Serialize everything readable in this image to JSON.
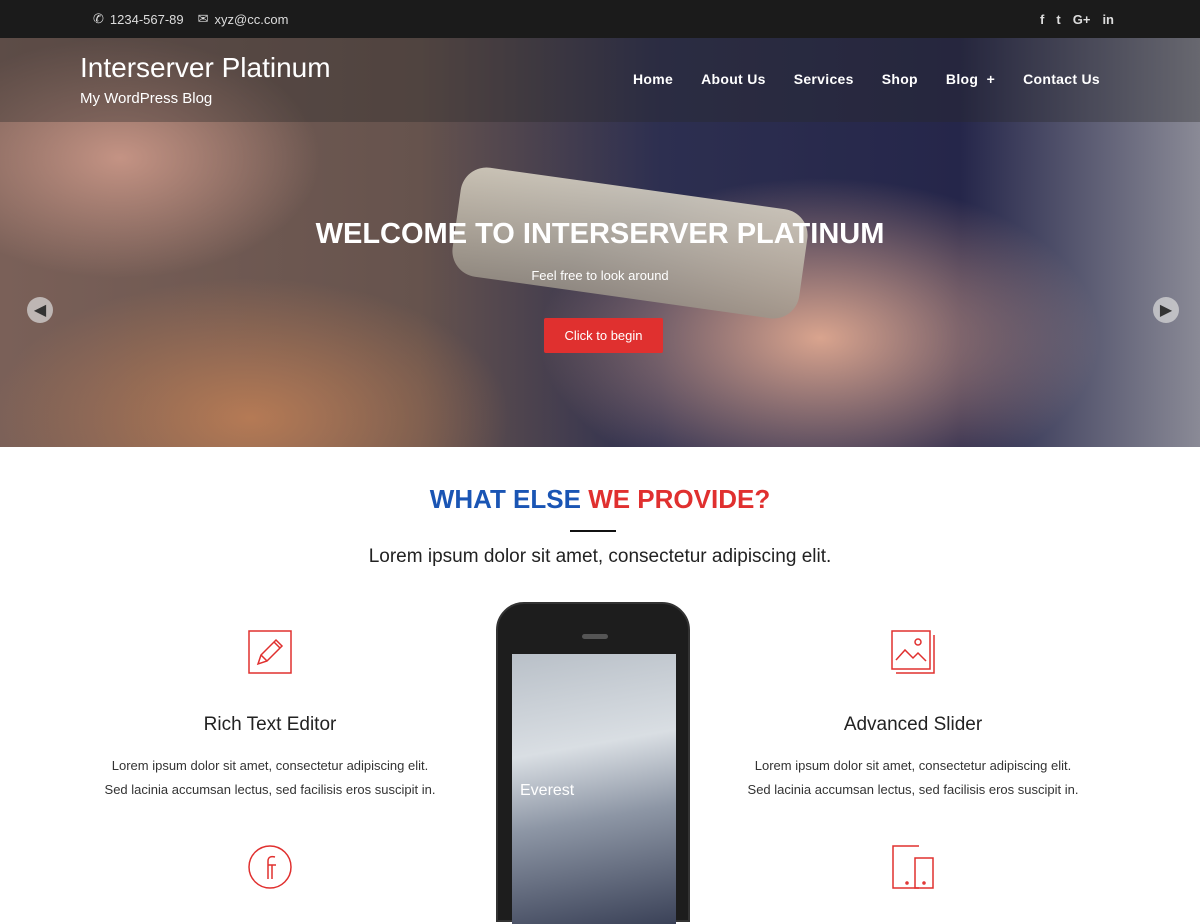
{
  "topbar": {
    "phone": "1234-567-89",
    "email": "xyz@cc.com",
    "social": [
      "f",
      "t",
      "G+",
      "in"
    ]
  },
  "brand": {
    "title": "Interserver Platinum",
    "tagline": "My WordPress Blog"
  },
  "nav": [
    "Home",
    "About Us",
    "Services",
    "Shop",
    "Blog  +",
    "Contact Us"
  ],
  "hero": {
    "title": "WELCOME TO INTERSERVER PLATINUM",
    "subtitle": "Feel free to look around",
    "cta": "Click to begin"
  },
  "section": {
    "title_part1": "WHAT ELSE",
    "title_part2": "WE PROVIDE?",
    "subtitle": "Lorem ipsum dolor sit amet, consectetur adipiscing elit."
  },
  "features": [
    {
      "icon": "pencil-icon",
      "title": "Rich Text Editor",
      "line1": "Lorem ipsum dolor sit amet, consectetur adipiscing elit.",
      "line2": "Sed lacinia accumsan lectus, sed facilisis eros suscipit in."
    },
    {
      "icon": "image-icon",
      "title": "Advanced Slider",
      "line1": "Lorem ipsum dolor sit amet, consectetur adipiscing elit.",
      "line2": "Sed lacinia accumsan lectus, sed facilisis eros suscipit in."
    },
    {
      "icon": "facebook-icon"
    },
    {
      "icon": "devices-icon"
    }
  ],
  "mockup": {
    "screen_text": "Everest"
  },
  "colors": {
    "accent": "#e0302f",
    "blue": "#1a55b4",
    "topbar": "#1b1b1b"
  }
}
